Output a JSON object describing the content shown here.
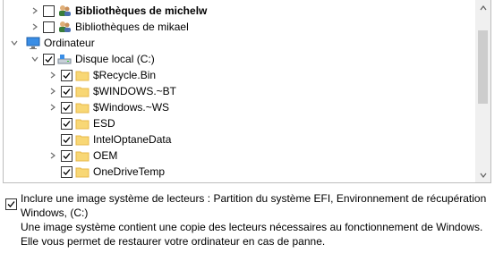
{
  "tree": {
    "items": [
      {
        "label": "Bibliothèques de michelw",
        "bold": true
      },
      {
        "label": "Bibliothèques de mikael",
        "bold": false
      },
      {
        "label": "Ordinateur"
      },
      {
        "label": "Disque local (C:)"
      },
      {
        "label": "$Recycle.Bin"
      },
      {
        "label": "$WINDOWS.~BT"
      },
      {
        "label": "$Windows.~WS"
      },
      {
        "label": "ESD"
      },
      {
        "label": "IntelOptaneData"
      },
      {
        "label": "OEM"
      },
      {
        "label": "OneDriveTemp"
      }
    ]
  },
  "option": {
    "checked": true,
    "label": "Inclure une image système de lecteurs : Partition du système EFI, Environnement de récupération Windows, (C:)"
  },
  "description": "Une image système contient une copie des lecteurs nécessaires au fonctionnement de Windows. Elle vous permet de restaurer votre ordinateur en cas de panne.",
  "colors": {
    "folder": "#f8d775",
    "folder_dark": "#e8b84a",
    "computer": "#3a8ee6"
  }
}
